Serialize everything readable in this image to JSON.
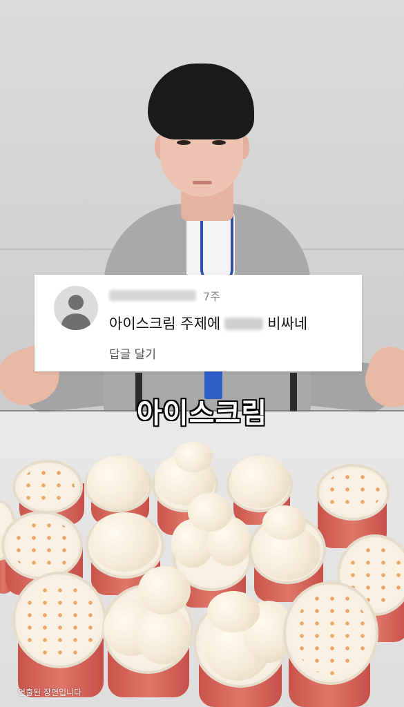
{
  "comment": {
    "time": "7주",
    "text_before": "아이스크림 주제에",
    "text_after": "비싸네",
    "reply": "답글 달기"
  },
  "caption": "아이스크림",
  "disclaimer": "연출된 장면입니다",
  "colors": {
    "cup_red": "#d8665b",
    "lid_cream": "#f7f0e3",
    "caption_text": "#ffffff",
    "caption_outline": "#000000"
  },
  "icons": {
    "avatar": "default-profile-avatar-icon"
  }
}
